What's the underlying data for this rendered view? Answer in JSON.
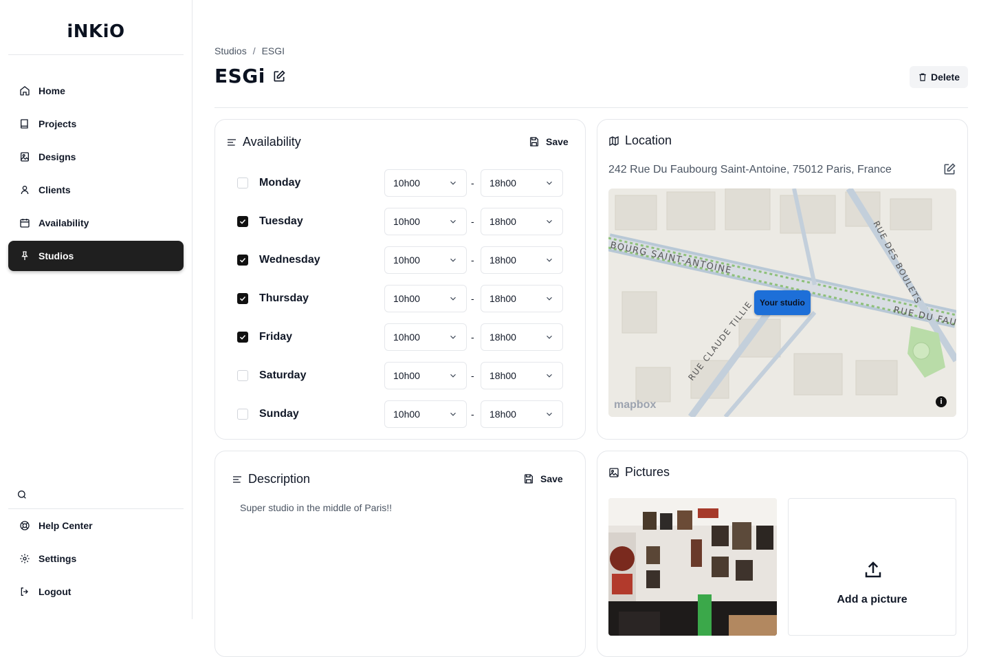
{
  "brand": {
    "logo_text": "iNKiO"
  },
  "sidebar": {
    "items": [
      {
        "label": "Home",
        "icon": "home-icon"
      },
      {
        "label": "Projects",
        "icon": "book-icon"
      },
      {
        "label": "Designs",
        "icon": "image-icon"
      },
      {
        "label": "Clients",
        "icon": "user-icon"
      },
      {
        "label": "Availability",
        "icon": "calendar-icon"
      },
      {
        "label": "Studios",
        "icon": "pin-icon",
        "active": true
      }
    ],
    "bottom_items": [
      {
        "label": "Help Center",
        "icon": "lifebuoy-icon"
      },
      {
        "label": "Settings",
        "icon": "gear-icon"
      },
      {
        "label": "Logout",
        "icon": "logout-icon"
      }
    ]
  },
  "breadcrumb": {
    "root": "Studios",
    "separator": "/",
    "current": "ESGI"
  },
  "page": {
    "title": "ESGi",
    "delete_label": "Delete"
  },
  "availability": {
    "title": "Availability",
    "save_label": "Save",
    "days": [
      {
        "name": "Monday",
        "checked": false,
        "start": "10h00",
        "end": "18h00"
      },
      {
        "name": "Tuesday",
        "checked": true,
        "start": "10h00",
        "end": "18h00"
      },
      {
        "name": "Wednesday",
        "checked": true,
        "start": "10h00",
        "end": "18h00"
      },
      {
        "name": "Thursday",
        "checked": true,
        "start": "10h00",
        "end": "18h00"
      },
      {
        "name": "Friday",
        "checked": true,
        "start": "10h00",
        "end": "18h00"
      },
      {
        "name": "Saturday",
        "checked": false,
        "start": "10h00",
        "end": "18h00"
      },
      {
        "name": "Sunday",
        "checked": false,
        "start": "10h00",
        "end": "18h00"
      }
    ],
    "range_separator": "-"
  },
  "location": {
    "title": "Location",
    "address": "242 Rue Du Faubourg Saint-Antoine, 75012 Paris, France",
    "map": {
      "marker_label": "Your studio",
      "street_labels": [
        "BOURG SAINT-ANTOINE",
        "RUE DES BOULETS",
        "RUE DU FAU",
        "RUE CLAUDE TILLIE"
      ],
      "attribution": "mapbox",
      "marker_color": "#1d6fd8"
    }
  },
  "description": {
    "title": "Description",
    "save_label": "Save",
    "text": "Super studio in the middle of Paris!!"
  },
  "pictures": {
    "title": "Pictures",
    "add_label": "Add a picture"
  },
  "colors": {
    "active_nav_bg": "#1f1f1f",
    "border": "#e5e7eb",
    "accent": "#1d6fd8"
  }
}
